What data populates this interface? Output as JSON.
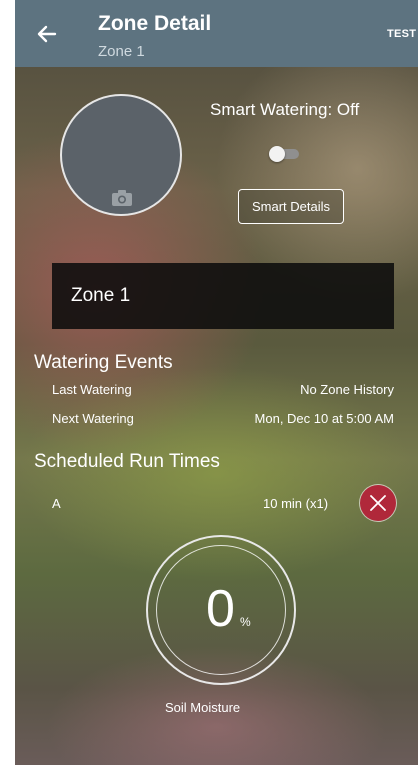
{
  "header": {
    "title": "Zone Detail",
    "subtitle": "Zone 1",
    "test_label": "TEST",
    "color": "#5d7380"
  },
  "photo": {
    "icon": "camera-icon"
  },
  "smart_watering": {
    "label": "Smart Watering: Off",
    "enabled": false,
    "details_label": "Smart Details"
  },
  "zone": {
    "name": "Zone 1"
  },
  "watering_events": {
    "title": "Watering Events",
    "last_label": "Last Watering",
    "last_value": "No Zone History",
    "next_label": "Next Watering",
    "next_value": "Mon, Dec 10 at 5:00 AM"
  },
  "scheduled_run_times": {
    "title": "Scheduled Run Times",
    "items": [
      {
        "program": "A",
        "duration": "10 min (x1)"
      }
    ],
    "delete_color": "#b0283a"
  },
  "soil_moisture": {
    "value": "0",
    "unit": "%",
    "label": "Soil Moisture"
  }
}
